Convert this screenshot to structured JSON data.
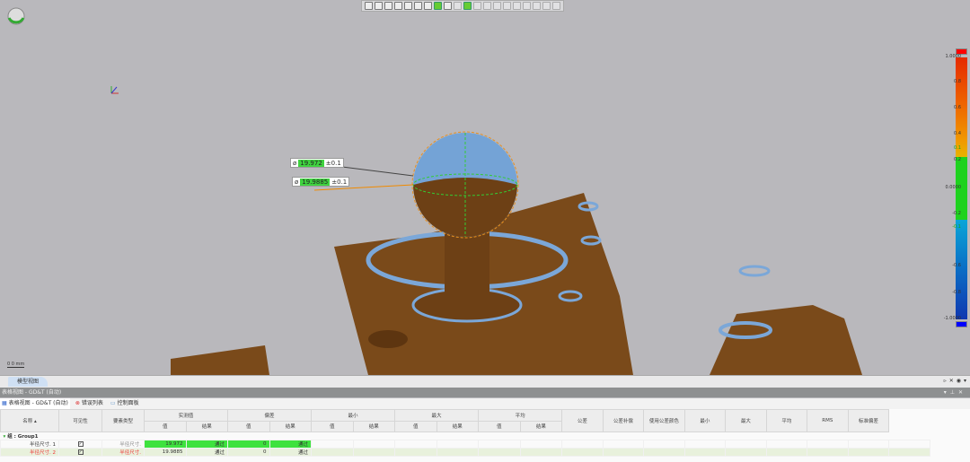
{
  "toolbar": {
    "icons": [
      "sphere-view-icon",
      "cube-view-icon",
      "copy-icon",
      "align-left-icon",
      "align-bottom-icon",
      "split-view-icon",
      "house-icon",
      "grid-icon",
      "section-icon",
      "line-icon",
      "select-box-icon",
      "circle-icon",
      "circle2-icon",
      "cloud-icon",
      "lasso-icon",
      "check-icon",
      "plane-icon",
      "user-icon",
      "link-icon",
      "settings-icon"
    ]
  },
  "annotations": [
    {
      "symbol": "ø",
      "value": "19.972",
      "tol": "±0.1"
    },
    {
      "symbol": "ø",
      "value": "19.9885",
      "tol": "±0.1"
    }
  ],
  "scale_readout": "0 0 mm",
  "color_scale": {
    "ticks": [
      "1.0000",
      "0.8",
      "0.6",
      "0.4",
      "0.1",
      "0.2",
      "0.0000",
      "-0.2",
      "-0.1",
      "-0.6",
      "-0.8",
      "-1.0000"
    ],
    "colors": {
      "max": "#ff0000",
      "min": "#0000ff",
      "pass": "#1ed21e"
    }
  },
  "model_tab": "模型视图",
  "panel": {
    "title": "表格视图 - GD&T (自动)",
    "tabs": [
      "表格视图 - GD&T (自动)",
      "错误列表",
      "控制面板"
    ]
  },
  "table": {
    "headers": {
      "name": "名称",
      "visible": "可见性",
      "type": "要素类型",
      "measured": "实测值",
      "deviation": "偏差",
      "min": "最小",
      "max": "最大",
      "avg": "平均",
      "value": "值",
      "result": "结果",
      "tolerance": "公差",
      "tol_comp": "公差补偿",
      "use_tol_color": "使用公差颜色",
      "min2": "最小",
      "max2": "最大",
      "avg2": "平均",
      "rms": "RMS",
      "std": "标准偏差"
    },
    "group": "组 : Group1",
    "rows": [
      {
        "name": "半径尺寸. 1",
        "type": "半径尺寸.",
        "measured": "19.972",
        "measured_result": "通过",
        "deviation": "0",
        "deviation_result": "通过"
      },
      {
        "name": "半径尺寸. 2",
        "type": "半径尺寸.",
        "measured": "19.9885",
        "measured_result": "通过",
        "deviation": "0",
        "deviation_result": "通过"
      }
    ]
  }
}
